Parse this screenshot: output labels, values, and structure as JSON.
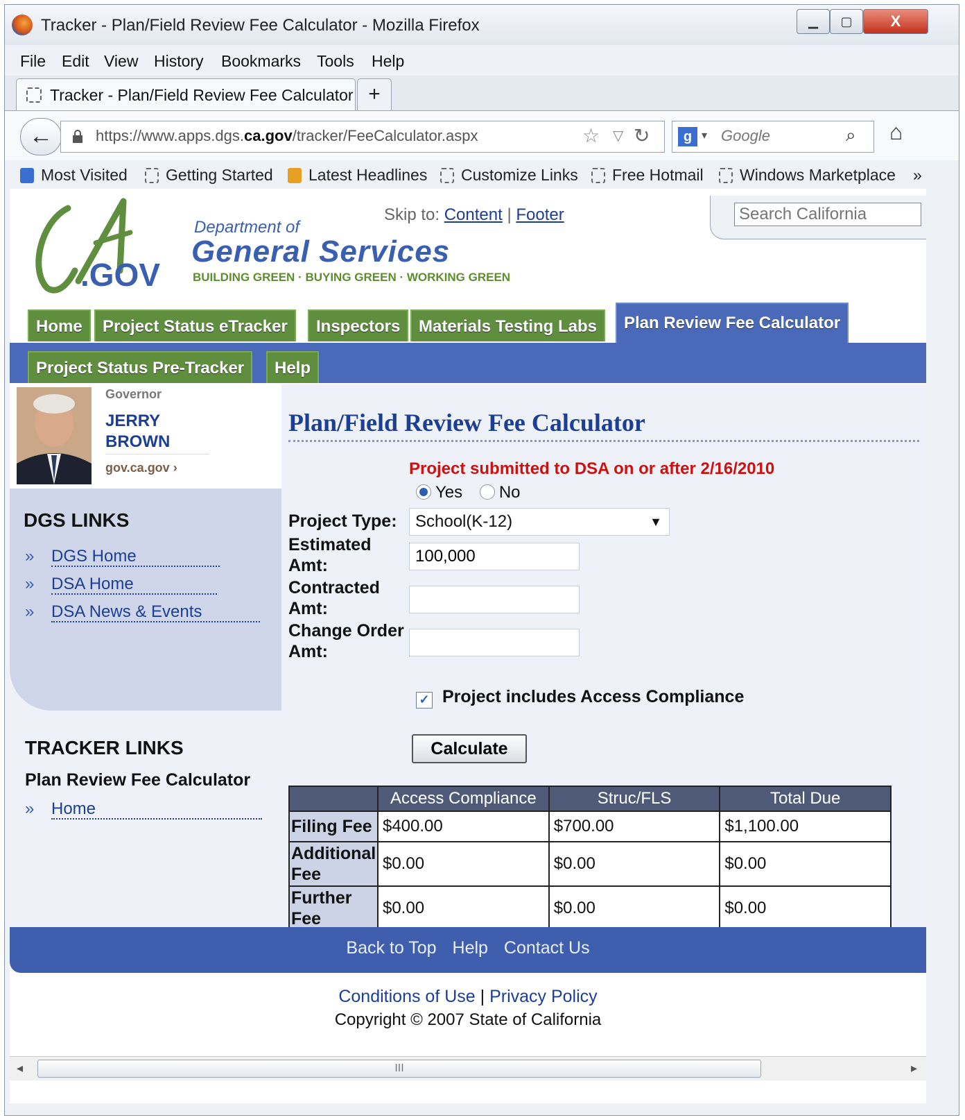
{
  "window": {
    "title": "Tracker - Plan/Field Review Fee Calculator - Mozilla Firefox"
  },
  "menu": [
    "File",
    "Edit",
    "View",
    "History",
    "Bookmarks",
    "Tools",
    "Help"
  ],
  "tab": {
    "label": "Tracker - Plan/Field Review Fee Calculator",
    "new_tab": "+"
  },
  "address": {
    "url_prefix": "https://www.apps.dgs.",
    "url_domain": "ca.gov",
    "url_suffix": "/tracker/FeeCalculator.aspx"
  },
  "search": {
    "placeholder": "Google"
  },
  "bookmarks": [
    "Most Visited",
    "Getting Started",
    "Latest Headlines",
    "Customize Links",
    "Free Hotmail",
    "Windows Marketplace"
  ],
  "header": {
    "skip_label": "Skip to:",
    "skip_links": [
      "Content",
      "Footer"
    ],
    "dept_of": "Department of",
    "dept_name": "General Services",
    "slogan": "BUILDING GREEN · BUYING GREEN · WORKING GREEN",
    "logo_gov": ".GOV",
    "search_placeholder": "Search California"
  },
  "nav": {
    "row1": [
      "Home",
      "Project Status eTracker",
      "Inspectors",
      "Materials Testing Labs",
      "Plan Review Fee Calculator"
    ],
    "row2": [
      "Project Status Pre-Tracker",
      "Help"
    ],
    "active": "Plan Review Fee Calculator"
  },
  "governor": {
    "label": "Governor",
    "name_first": "JERRY",
    "name_last": "BROWN",
    "link": "gov.ca.gov ›"
  },
  "dgs_links": {
    "title": "DGS LINKS",
    "items": [
      "DGS Home",
      "DSA Home",
      "DSA News & Events"
    ]
  },
  "tracker_links": {
    "title": "TRACKER LINKS",
    "subtitle": "Plan Review Fee Calculator",
    "items": [
      "Home"
    ]
  },
  "form": {
    "title": "Plan/Field Review Fee Calculator",
    "question": "Project submitted to DSA on or after 2/16/2010",
    "yes": "Yes",
    "no": "No",
    "selected_radio": "Yes",
    "project_type_label": "Project Type:",
    "project_type_value": "School(K-12)",
    "estimated_label_1": "Estimated",
    "estimated_label_2": "Amt:",
    "estimated_value": "100,000",
    "contracted_label_1": "Contracted",
    "contracted_label_2": "Amt:",
    "contracted_value": "",
    "change_label_1": "Change Order",
    "change_label_2": "Amt:",
    "change_value": "",
    "access_label": "Project includes Access Compliance",
    "access_checked": true,
    "calculate": "Calculate"
  },
  "fees": {
    "columns": [
      "",
      "Access Compliance",
      "Struc/FLS",
      "Total Due"
    ],
    "rows": [
      {
        "label_1": "Filing Fee",
        "label_2": "",
        "values": [
          "$400.00",
          "$700.00",
          "$1,100.00"
        ]
      },
      {
        "label_1": "Additional",
        "label_2": "Fee",
        "values": [
          "$0.00",
          "$0.00",
          "$0.00"
        ]
      },
      {
        "label_1": "Further",
        "label_2": "Fee",
        "values": [
          "$0.00",
          "$0.00",
          "$0.00"
        ]
      }
    ]
  },
  "footer": {
    "links": [
      "Back to Top",
      "Help",
      "Contact Us"
    ],
    "legal": [
      "Conditions of Use",
      "Privacy Policy"
    ],
    "copyright": "Copyright © 2007 State of California"
  },
  "scrollbar": {
    "thumb_grip": "III"
  },
  "colors": {
    "brand_blue": "#3a5fb0",
    "nav_green": "#5f8f3e",
    "alert_red": "#cc1111"
  }
}
